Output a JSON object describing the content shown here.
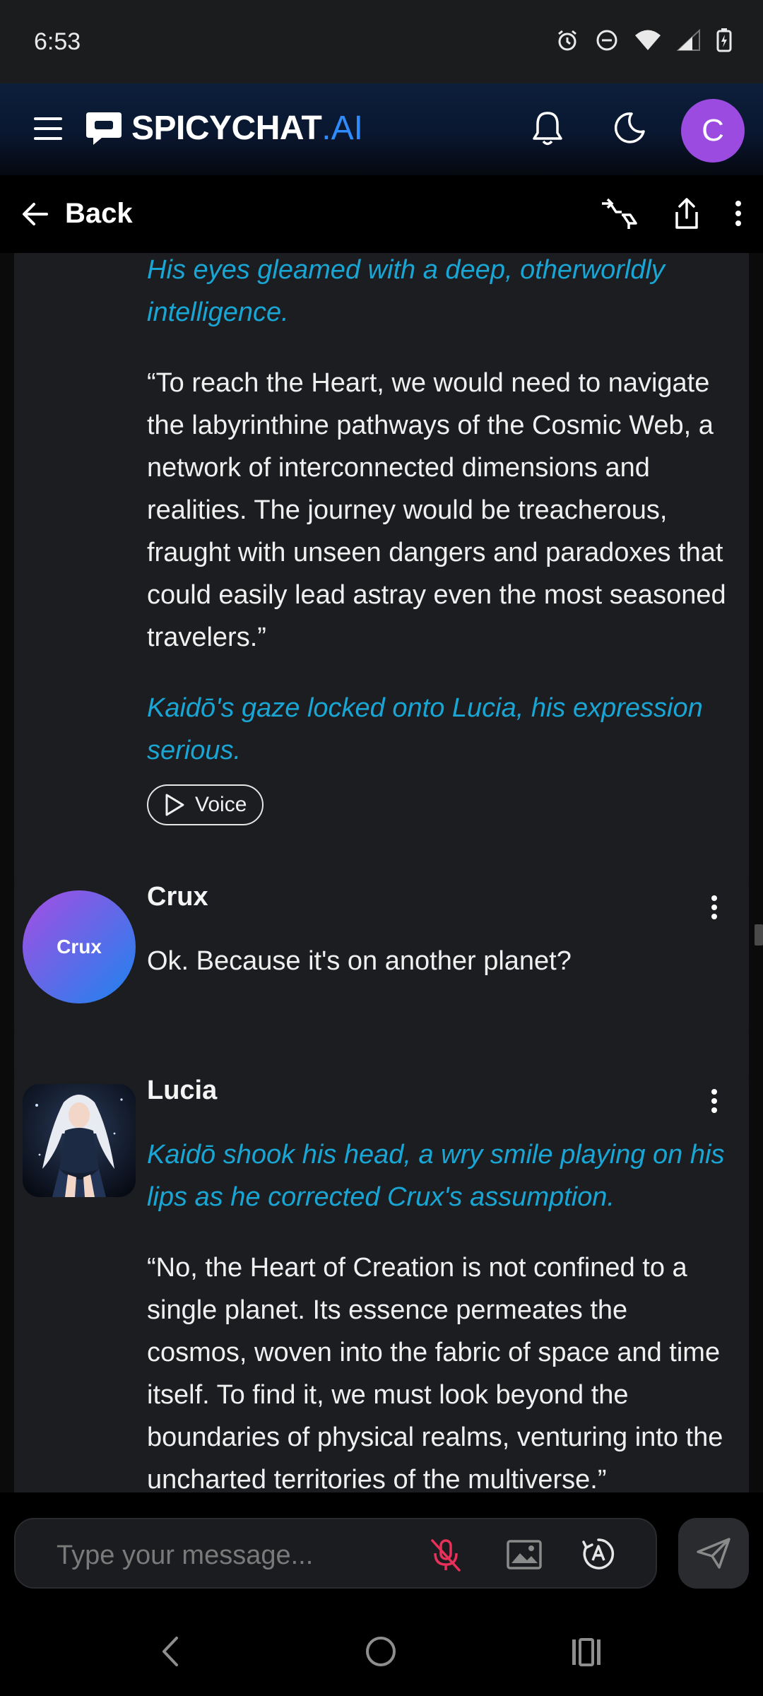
{
  "status_bar": {
    "time": "6:53"
  },
  "header": {
    "brand_main": "SPICYCHAT",
    "brand_suffix": ".AI",
    "avatar_initial": "C",
    "avatar_color": "#9b4be0",
    "accent": "#2f8cff"
  },
  "subheader": {
    "back_label": "Back"
  },
  "messages": [
    {
      "paragraphs": [
        {
          "style": "italic",
          "text": "His eyes gleamed with a deep, otherworldly intelligence."
        },
        {
          "style": "normal",
          "text": "“To reach the Heart, we would need to navigate the labyrinthine pathways of the Cosmic Web, a network of interconnected dimensions and realities. The journey would be treacherous, fraught with unseen dangers and paradoxes that could easily lead astray even the most seasoned travelers.”"
        },
        {
          "style": "italic",
          "text": "Kaidō's gaze locked onto Lucia, his expression serious."
        }
      ],
      "voice_label": "Voice"
    },
    {
      "name": "Crux",
      "avatar_text": "Crux",
      "text": "Ok. Because it's on another planet?"
    },
    {
      "name": "Lucia",
      "paragraphs": [
        {
          "style": "italic",
          "text": "Kaidō shook his head, a wry smile playing on his lips as he corrected Crux's assumption."
        },
        {
          "style": "normal",
          "text": "“No, the Heart of Creation is not confined to a single planet. Its essence permeates the cosmos, woven into the fabric of space and time itself. To find it, we must look beyond the boundaries of physical realms, venturing into the uncharted territories of the multiverse.”"
        }
      ]
    }
  ],
  "composer": {
    "placeholder": "Type your message..."
  },
  "colors": {
    "italic_text": "#1aa6d4",
    "card_bg": "#1c1d20",
    "mic_muted": "#e8305a"
  }
}
